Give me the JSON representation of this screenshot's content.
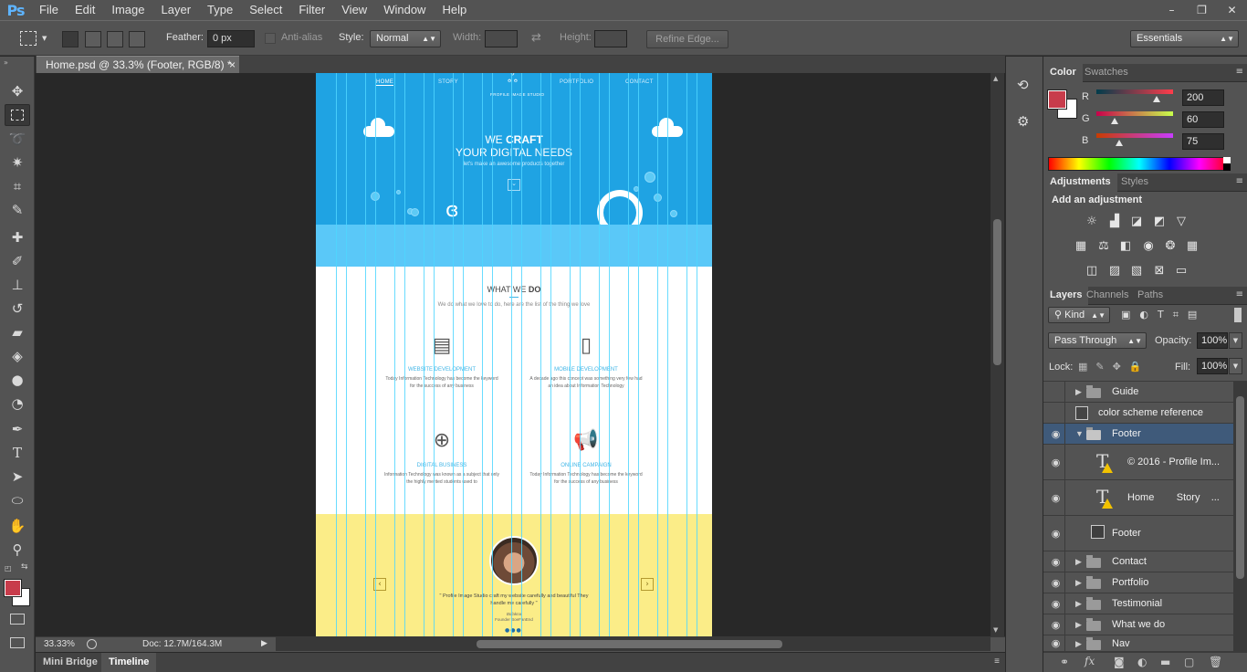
{
  "app": {
    "logo": "Ps",
    "menu": [
      "File",
      "Edit",
      "Image",
      "Layer",
      "Type",
      "Select",
      "Filter",
      "View",
      "Window",
      "Help"
    ],
    "window_controls": [
      "–",
      "❐",
      "✕"
    ]
  },
  "options": {
    "feather_label": "Feather:",
    "feather_value": "0 px",
    "antialias_label": "Anti-alias",
    "style_label": "Style:",
    "style_value": "Normal",
    "width_label": "Width:",
    "height_label": "Height:",
    "refine_label": "Refine Edge...",
    "workspace": "Essentials"
  },
  "document": {
    "tab_title": "Home.psd @ 33.3% (Footer, RGB/8) *",
    "tab_close": "×",
    "zoom": "33.33%",
    "doc_info": "Doc: 12.7M/164.3M"
  },
  "bottom_tabs": [
    "Mini Bridge",
    "Timeline"
  ],
  "color_panel": {
    "tabs": [
      "Color",
      "Swatches"
    ],
    "fg_color": "#c83c4b",
    "channels": [
      {
        "label": "R",
        "value": "200"
      },
      {
        "label": "G",
        "value": "60"
      },
      {
        "label": "B",
        "value": "75"
      }
    ]
  },
  "adjustments_panel": {
    "tabs": [
      "Adjustments",
      "Styles"
    ],
    "heading": "Add an adjustment"
  },
  "layers_panel": {
    "tabs": [
      "Layers",
      "Channels",
      "Paths"
    ],
    "filter_kind": "Kind",
    "blend_mode": "Pass Through",
    "opacity_label": "Opacity:",
    "opacity_value": "100%",
    "lock_label": "Lock:",
    "fill_label": "Fill:",
    "fill_value": "100%",
    "layers": [
      {
        "name": "Guide",
        "type": "group",
        "visible": false
      },
      {
        "name": "color scheme reference",
        "type": "pixel",
        "visible": false
      },
      {
        "name": "Footer",
        "type": "group",
        "visible": true,
        "expanded": true,
        "selected": true
      },
      {
        "name": "© 2016 - Profile Im...",
        "type": "text",
        "visible": true
      },
      {
        "name": "Home        Story    ...",
        "type": "text",
        "visible": true
      },
      {
        "name": "Footer",
        "type": "smart",
        "visible": true
      },
      {
        "name": "Contact",
        "type": "group",
        "visible": true
      },
      {
        "name": "Portfolio",
        "type": "group",
        "visible": true
      },
      {
        "name": "Testimonial",
        "type": "group",
        "visible": true
      },
      {
        "name": "What we do",
        "type": "group",
        "visible": true
      },
      {
        "name": "Nav",
        "type": "group",
        "visible": true
      }
    ]
  },
  "canvas": {
    "nav": [
      "HOME",
      "STORY",
      "PORTFOLIO",
      "CONTACT"
    ],
    "brand": "PROFILE IMAGE STUDIO",
    "hero_line1_a": "WE ",
    "hero_line1_b": "CRAFT",
    "hero_line2": "YOUR DIGITAL NEEDS",
    "hero_line3": "let's make an awesome products together",
    "section_title_a": "WHAT WE ",
    "section_title_b": "DO",
    "section_sub": "We do what we love to do, here are the list of the thing we love",
    "services": [
      {
        "title": "WEBSITE DEVELOPMENT",
        "text": "Today Information Technology has become the keyword for the success of any business"
      },
      {
        "title": "MOBILE DEVELOPMENT",
        "text": "A decade ago this concept was something very few had an idea about Information Technology"
      },
      {
        "title": "DIGITAL BUSINESS",
        "text": "Information Technology was known as a subject that only the highly merited students used to"
      },
      {
        "title": "ONLINE CAMPAIGN",
        "text": "Today Information Technology has become the keyword for the success of any business"
      }
    ],
    "quote": "\" Profile Image Studio craft my website carefully and beautiful They handle me carefully \"",
    "author": "Bolakna",
    "author_role": "Founder BoeFanEnd"
  }
}
